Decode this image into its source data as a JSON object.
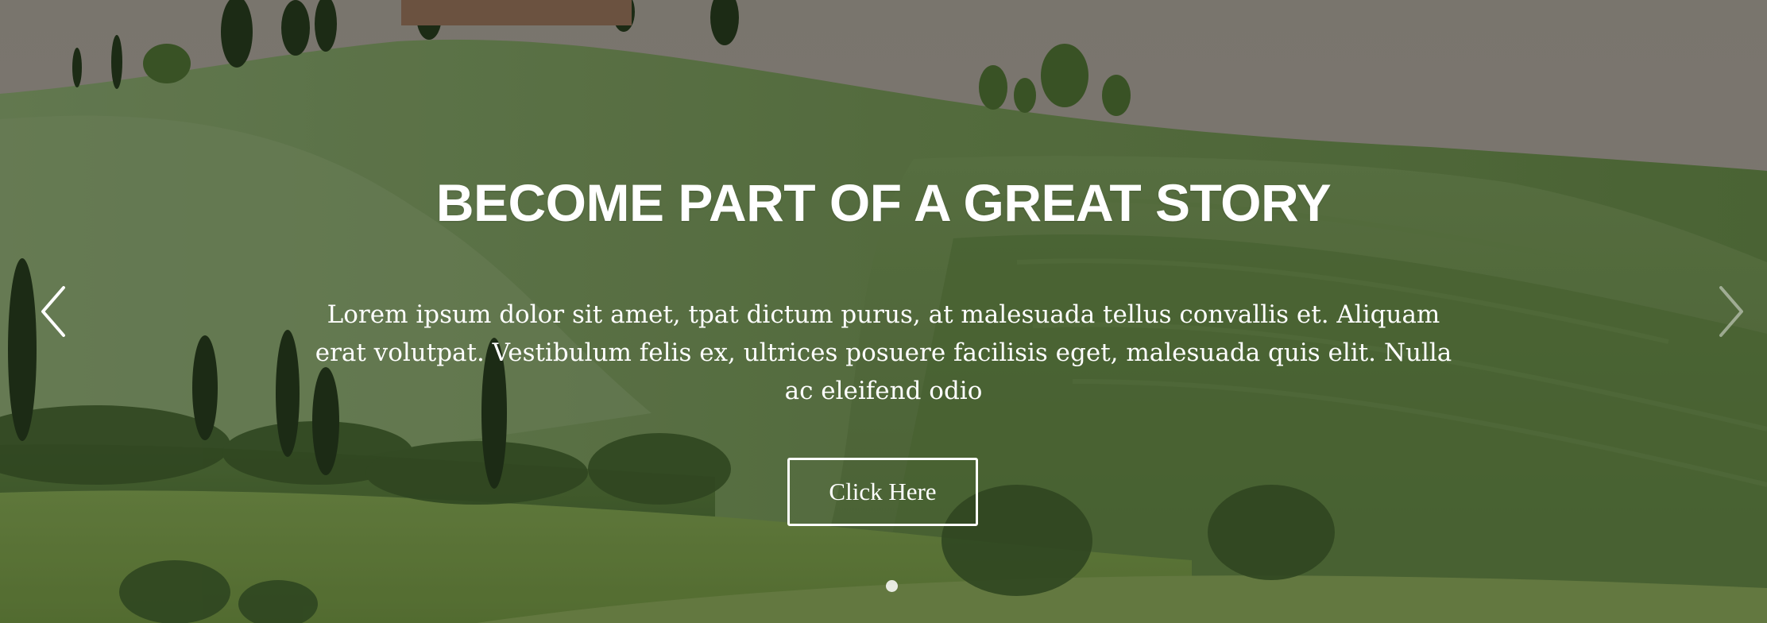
{
  "hero": {
    "title": "BECOME PART OF A GREAT STORY",
    "description": "Lorem ipsum dolor sit amet, tpat dictum purus, at malesuada tellus convallis et. Aliquam erat volutpat. Vestibulum felis ex, ultrices posuere facilisis eget, malesuada quis elit. Nulla ac eleifend odio",
    "button_label": "Click Here",
    "background_image": "tuscany-green-hills-landscape"
  },
  "slider": {
    "prev_icon": "chevron-left-icon",
    "next_icon": "chevron-right-icon",
    "total_slides": 1,
    "active_slide": 1
  },
  "colors": {
    "text": "#ffffff",
    "sky": "#8e8a82",
    "hills": "#5f7e45"
  }
}
